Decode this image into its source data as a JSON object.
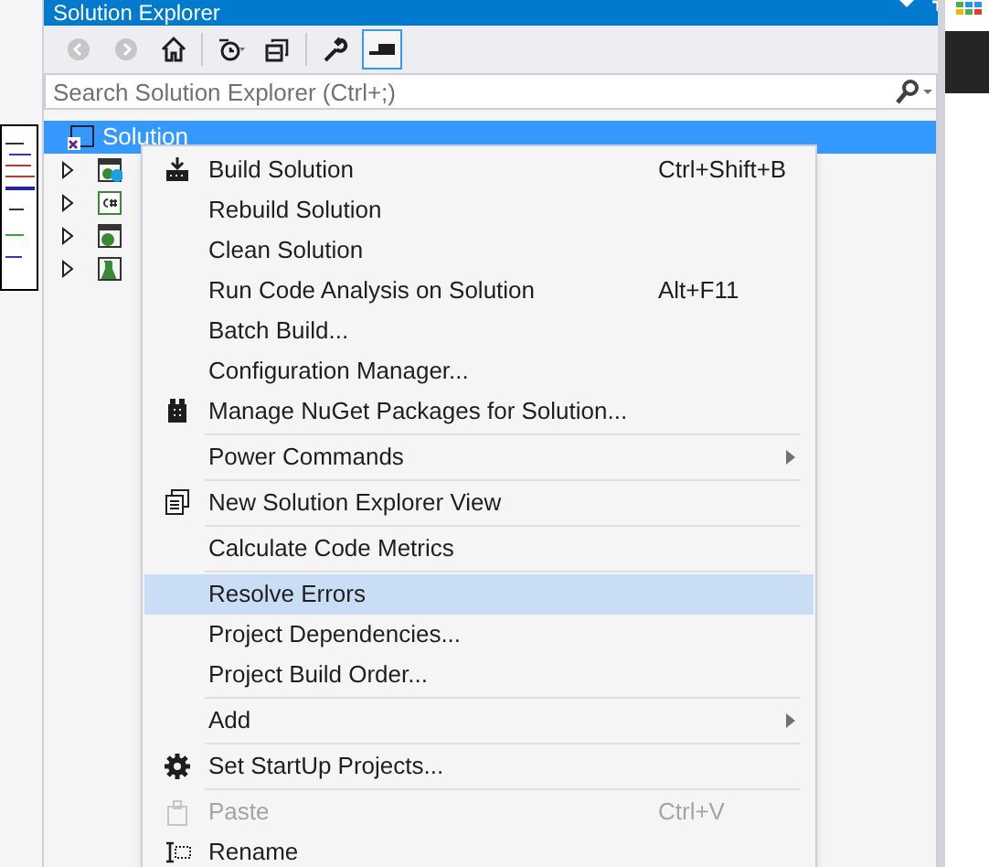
{
  "window": {
    "title": "Solution Explorer"
  },
  "toolbar": [
    {
      "disabled": true,
      "selected": false
    },
    {
      "disabled": true,
      "selected": false
    },
    {
      "disabled": false,
      "selected": false
    },
    {
      "disabled": false,
      "selected": false
    },
    {
      "disabled": false,
      "selected": false
    },
    {
      "disabled": false,
      "selected": false
    },
    {
      "disabled": false,
      "selected": true
    }
  ],
  "search": {
    "placeholder": "Search Solution Explorer (Ctrl+;)"
  },
  "tree": [
    {
      "label": "Solution",
      "selected": true,
      "children": [
        {
          "kind": "service",
          "expanded": false
        },
        {
          "kind": "csharp",
          "expanded": false
        },
        {
          "kind": "web",
          "expanded": false
        },
        {
          "kind": "test",
          "expanded": false
        }
      ]
    }
  ],
  "context_menu": [
    {
      "kind": "item",
      "label": "Build Solution",
      "shortcut": "Ctrl+Shift+B",
      "submenu": false,
      "disabled": false,
      "selected": false
    },
    {
      "kind": "item",
      "label": "Rebuild Solution",
      "submenu": false,
      "disabled": false,
      "selected": false
    },
    {
      "kind": "item",
      "label": "Clean Solution",
      "submenu": false,
      "disabled": false,
      "selected": false
    },
    {
      "kind": "item",
      "label": "Run Code Analysis on Solution",
      "shortcut": "Alt+F11",
      "submenu": false,
      "disabled": false,
      "selected": false
    },
    {
      "kind": "item",
      "label": "Batch Build...",
      "submenu": false,
      "disabled": false,
      "selected": false
    },
    {
      "kind": "item",
      "label": "Configuration Manager...",
      "submenu": false,
      "disabled": false,
      "selected": false
    },
    {
      "kind": "item",
      "label": "Manage NuGet Packages for Solution...",
      "submenu": false,
      "disabled": false,
      "selected": false
    },
    {
      "kind": "separator"
    },
    {
      "kind": "item",
      "label": "Power Commands",
      "submenu": true,
      "disabled": false,
      "selected": false
    },
    {
      "kind": "separator"
    },
    {
      "kind": "item",
      "label": "New Solution Explorer View",
      "submenu": false,
      "disabled": false,
      "selected": false
    },
    {
      "kind": "separator"
    },
    {
      "kind": "item",
      "label": "Calculate Code Metrics",
      "submenu": false,
      "disabled": false,
      "selected": false
    },
    {
      "kind": "separator"
    },
    {
      "kind": "item",
      "label": "Resolve Errors",
      "submenu": false,
      "disabled": false,
      "selected": true
    },
    {
      "kind": "item",
      "label": "Project Dependencies...",
      "submenu": false,
      "disabled": false,
      "selected": false
    },
    {
      "kind": "item",
      "label": "Project Build Order...",
      "submenu": false,
      "disabled": false,
      "selected": false
    },
    {
      "kind": "separator"
    },
    {
      "kind": "item",
      "label": "Add",
      "submenu": true,
      "disabled": false,
      "selected": false
    },
    {
      "kind": "separator"
    },
    {
      "kind": "item",
      "label": "Set StartUp Projects...",
      "submenu": false,
      "disabled": false,
      "selected": false
    },
    {
      "kind": "separator"
    },
    {
      "kind": "item",
      "label": "Paste",
      "shortcut": "Ctrl+V",
      "submenu": false,
      "disabled": true,
      "selected": false
    },
    {
      "kind": "item",
      "label": "Rename",
      "submenu": false,
      "disabled": false,
      "selected": false
    }
  ]
}
